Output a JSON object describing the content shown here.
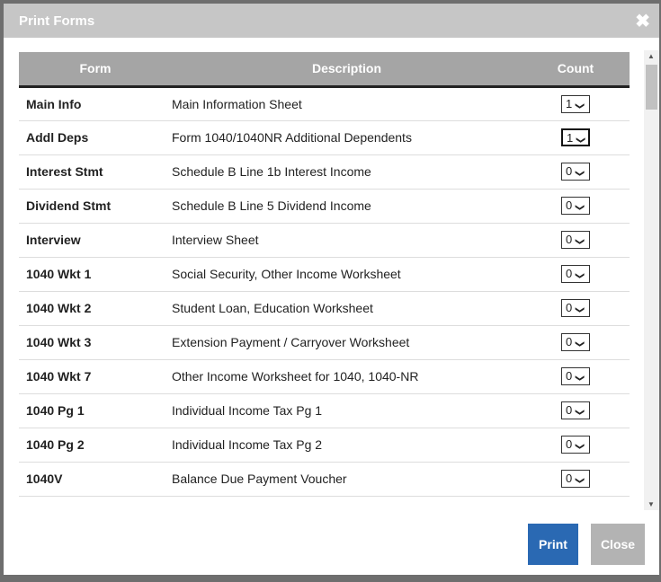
{
  "dialog": {
    "title": "Print Forms",
    "close_icon": "close-icon"
  },
  "table": {
    "headers": [
      "Form",
      "Description",
      "Count"
    ],
    "rows": [
      {
        "form": "Main Info",
        "description": "Main Information Sheet",
        "count": "1"
      },
      {
        "form": "Addl Deps",
        "description": "Form 1040/1040NR Additional Dependents",
        "count": "1"
      },
      {
        "form": "Interest Stmt",
        "description": "Schedule B Line 1b Interest Income",
        "count": "0"
      },
      {
        "form": "Dividend Stmt",
        "description": "Schedule B Line 5 Dividend Income",
        "count": "0"
      },
      {
        "form": "Interview",
        "description": "Interview Sheet",
        "count": "0"
      },
      {
        "form": "1040 Wkt 1",
        "description": "Social Security, Other Income Worksheet",
        "count": "0"
      },
      {
        "form": "1040 Wkt 2",
        "description": "Student Loan, Education Worksheet",
        "count": "0"
      },
      {
        "form": "1040 Wkt 3",
        "description": "Extension Payment / Carryover Worksheet",
        "count": "0"
      },
      {
        "form": "1040 Wkt 7",
        "description": "Other Income Worksheet for 1040, 1040-NR",
        "count": "0"
      },
      {
        "form": "1040 Pg 1",
        "description": "Individual Income Tax Pg 1",
        "count": "0"
      },
      {
        "form": "1040 Pg 2",
        "description": "Individual Income Tax Pg 2",
        "count": "0"
      },
      {
        "form": "1040V",
        "description": "Balance Due Payment Voucher",
        "count": "0"
      }
    ]
  },
  "buttons": {
    "print": "Print",
    "close": "Close"
  },
  "colors": {
    "print": "#2a69b3",
    "close": "#b3b3b3",
    "header": "#c6c6c6"
  }
}
